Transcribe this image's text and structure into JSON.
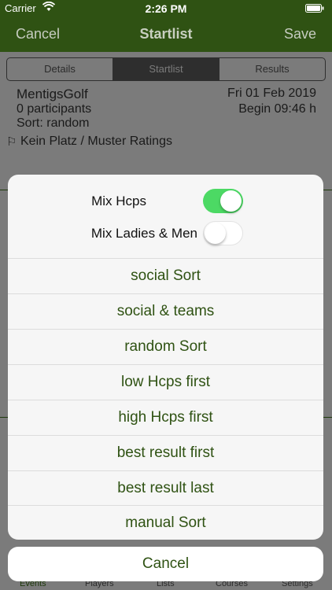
{
  "status": {
    "carrier": "Carrier",
    "time": "2:26 PM"
  },
  "nav": {
    "left": "Cancel",
    "title": "Startlist",
    "right": "Save"
  },
  "segments": [
    "Details",
    "Startlist",
    "Results"
  ],
  "event": {
    "name": "MentigsGolf",
    "participants": "0 participants",
    "sort": "Sort: random",
    "course": "Kein Platz / Muster Ratings",
    "date": "Fri 01 Feb 2019",
    "begin": "Begin 09:46 h"
  },
  "toggles": [
    {
      "label": "Mix Hcps",
      "state": "on"
    },
    {
      "label": "Mix Ladies & Men",
      "state": "off"
    }
  ],
  "options": [
    "social Sort",
    "social & teams",
    "random Sort",
    "low Hcps first",
    "high Hcps first",
    "best result first",
    "best result last",
    "manual Sort"
  ],
  "cancel_label": "Cancel",
  "tabs": [
    "Events",
    "Players",
    "Lists",
    "Courses",
    "Settings"
  ],
  "colors": {
    "brand": "#2f5213",
    "switch_on": "#4cd964"
  }
}
